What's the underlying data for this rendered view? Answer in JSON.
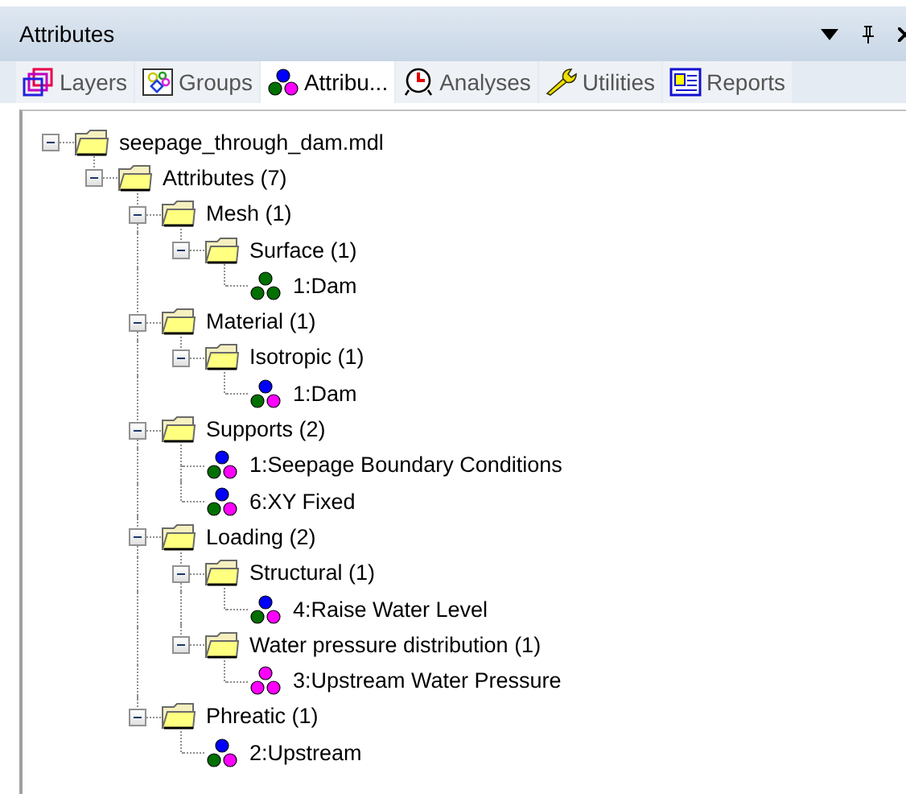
{
  "panel": {
    "title": "Attributes"
  },
  "tabs": [
    {
      "label": "Layers",
      "kind": "layers",
      "selected": false
    },
    {
      "label": "Groups",
      "kind": "groups",
      "selected": false
    },
    {
      "label": "Attribu...",
      "kind": "attributes",
      "selected": true
    },
    {
      "label": "Analyses",
      "kind": "analyses",
      "selected": false
    },
    {
      "label": "Utilities",
      "kind": "utilities",
      "selected": false
    },
    {
      "label": "Reports",
      "kind": "reports",
      "selected": false
    }
  ],
  "tree": [
    {
      "label": "seepage_through_dam.mdl",
      "kind": "folder",
      "expanded": true,
      "children": [
        {
          "label": "Attributes (7)",
          "kind": "folder",
          "expanded": true,
          "children": [
            {
              "label": "Mesh (1)",
              "kind": "folder",
              "expanded": true,
              "children": [
                {
                  "label": "Surface (1)",
                  "kind": "folder",
                  "expanded": true,
                  "children": [
                    {
                      "label": "1:Dam",
                      "kind": "attribute",
                      "dots": [
                        {
                          "color": "#007000"
                        },
                        {
                          "color": "#007000"
                        },
                        {
                          "color": "#007000"
                        }
                      ]
                    }
                  ]
                }
              ]
            },
            {
              "label": "Material (1)",
              "kind": "folder",
              "expanded": true,
              "children": [
                {
                  "label": "Isotropic (1)",
                  "kind": "folder",
                  "expanded": true,
                  "children": [
                    {
                      "label": "1:Dam",
                      "kind": "attribute",
                      "dots": [
                        {
                          "color": "#0000ff"
                        },
                        {
                          "color": "#007000"
                        },
                        {
                          "color": "#ff00ff"
                        }
                      ]
                    }
                  ]
                }
              ]
            },
            {
              "label": "Supports (2)",
              "kind": "folder",
              "expanded": true,
              "children": [
                {
                  "label": "1:Seepage Boundary Conditions",
                  "kind": "attribute",
                  "dots": [
                    {
                      "color": "#0000ff"
                    },
                    {
                      "color": "#007000"
                    },
                    {
                      "color": "#ff00ff"
                    }
                  ]
                },
                {
                  "label": "6:XY Fixed",
                  "kind": "attribute",
                  "dots": [
                    {
                      "color": "#0000ff"
                    },
                    {
                      "color": "#007000"
                    },
                    {
                      "color": "#ff00ff"
                    }
                  ]
                }
              ]
            },
            {
              "label": "Loading (2)",
              "kind": "folder",
              "expanded": true,
              "children": [
                {
                  "label": "Structural (1)",
                  "kind": "folder",
                  "expanded": true,
                  "children": [
                    {
                      "label": "4:Raise Water Level",
                      "kind": "attribute",
                      "dots": [
                        {
                          "color": "#0000ff"
                        },
                        {
                          "color": "#007000"
                        },
                        {
                          "color": "#ff00ff"
                        }
                      ]
                    }
                  ]
                },
                {
                  "label": "Water pressure distribution (1)",
                  "kind": "folder",
                  "expanded": true,
                  "children": [
                    {
                      "label": "3:Upstream Water Pressure",
                      "kind": "attribute",
                      "dots": [
                        {
                          "color": "#ff00ff"
                        },
                        {
                          "color": "#ff00ff"
                        },
                        {
                          "color": "#ff00ff"
                        }
                      ]
                    }
                  ]
                }
              ]
            },
            {
              "label": "Phreatic (1)",
              "kind": "folder",
              "expanded": true,
              "children": [
                {
                  "label": "2:Upstream",
                  "kind": "attribute",
                  "dots": [
                    {
                      "color": "#0000ff"
                    },
                    {
                      "color": "#007000"
                    },
                    {
                      "color": "#ff00ff"
                    }
                  ]
                }
              ]
            }
          ]
        }
      ]
    }
  ]
}
